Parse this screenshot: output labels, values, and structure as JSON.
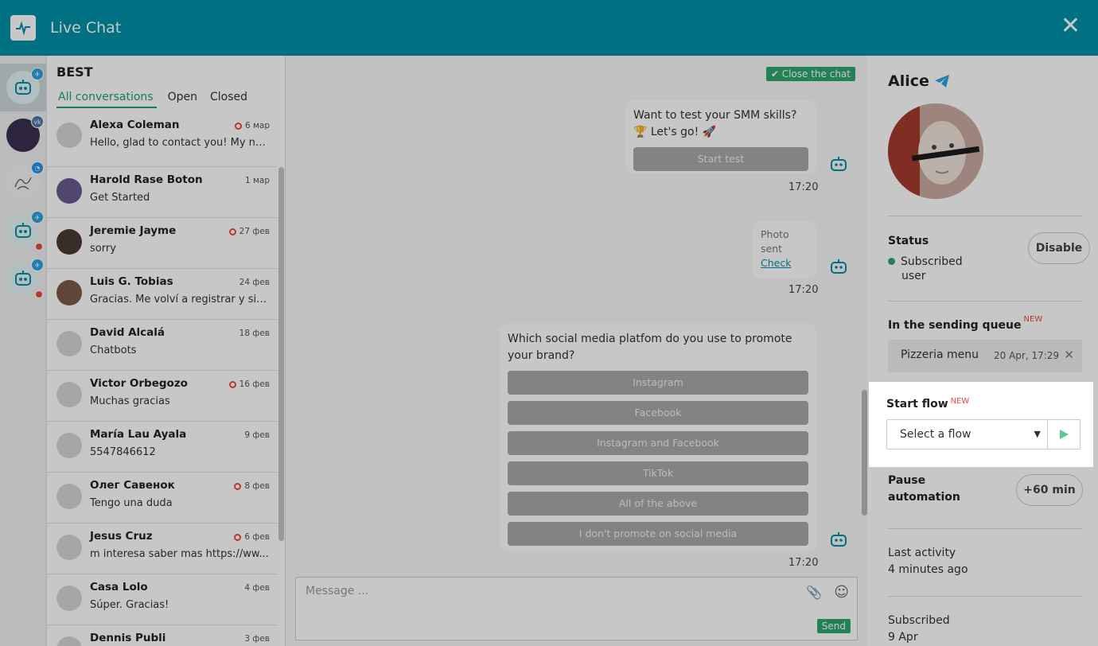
{
  "header": {
    "title": "Live Chat",
    "close_glyph": "✕"
  },
  "accounts": [
    {
      "name": "account-bot-telegram",
      "badge": "telegram",
      "active": true,
      "dot": false
    },
    {
      "name": "account-vk",
      "badge": "vk",
      "active": false,
      "dot": false
    },
    {
      "name": "account-messenger",
      "badge": "messenger",
      "active": false,
      "dot": false
    },
    {
      "name": "account-bot-telegram-2",
      "badge": "telegram",
      "active": false,
      "dot": true
    },
    {
      "name": "account-bot-telegram-3",
      "badge": "telegram",
      "active": false,
      "dot": true
    }
  ],
  "list": {
    "bot_name": "BEST",
    "tabs": [
      "All conversations",
      "Open",
      "Closed"
    ],
    "conversations": [
      {
        "name": "Alexa Coleman",
        "date": "6 мар",
        "unread": true,
        "msg": "Hello, glad to contact you! My na..."
      },
      {
        "name": "Harold Rase Boton",
        "date": "1 мар",
        "unread": false,
        "msg": "Get Started"
      },
      {
        "name": "Jeremie Jayme",
        "date": "27 фев",
        "unread": true,
        "msg": "sorry"
      },
      {
        "name": "Luis G. Tobias",
        "date": "24 фев",
        "unread": false,
        "msg": "Gracias. Me volví a registrar y si p..."
      },
      {
        "name": "David Alcalá",
        "date": "18 фев",
        "unread": false,
        "msg": "Chatbots"
      },
      {
        "name": "Victor Orbegozo",
        "date": "16 фев",
        "unread": true,
        "msg": "Muchas gracias"
      },
      {
        "name": "María Lau Ayala",
        "date": "9 фев",
        "unread": false,
        "msg": "5547846612"
      },
      {
        "name": "Олег Савенок",
        "date": "8 фев",
        "unread": true,
        "msg": "Tengo una duda"
      },
      {
        "name": "Jesus Cruz",
        "date": "6 фев",
        "unread": true,
        "msg": "m interesa saber mas https://ww..."
      },
      {
        "name": "Casa Lolo",
        "date": "4 фев",
        "unread": false,
        "msg": "Súper. Gracias!"
      },
      {
        "name": "Dennis Publi",
        "date": "3 фев",
        "unread": false,
        "msg": ""
      }
    ]
  },
  "chat": {
    "close_chat_label": "Close the chat",
    "msg1": {
      "text": "Want to test your SMM skills? 🏆 Let's go! 🚀",
      "button": "Start test",
      "time": "17:20"
    },
    "msg2": {
      "text": "Photo sent",
      "link": "Check",
      "time": "17:20"
    },
    "msg3": {
      "text": "Which social media platfom do you use to promote your brand?",
      "buttons": [
        "Instagram",
        "Facebook",
        "Instagram and Facebook",
        "TikTok",
        "All of the above",
        "I don't promote on social media"
      ],
      "time": "17:20"
    },
    "composer": {
      "placeholder": "Message ...",
      "send_label": "Send"
    }
  },
  "panel": {
    "user_name": "Alice",
    "status_label": "Status",
    "status_value_1": "Subscribed",
    "status_value_2": "user",
    "disable_label": "Disable",
    "queue_label": "In the sending queue",
    "new_badge": "NEW",
    "queue_item": {
      "name": "Pizzeria menu",
      "date": "20 Apr, 17:29"
    },
    "start_flow_label": "Start flow",
    "flow_placeholder": "Select a flow",
    "pause_label_1": "Pause",
    "pause_label_2": "automation",
    "pause_button": "+60 min",
    "last_activity_label": "Last activity",
    "last_activity_value": "4 minutes ago",
    "subscribed_label": "Subscribed",
    "subscribed_value": "9 Apr"
  },
  "colors": {
    "header": "#0090a8",
    "accent_green": "#2ea66d",
    "unread_red": "#e74c3c"
  }
}
